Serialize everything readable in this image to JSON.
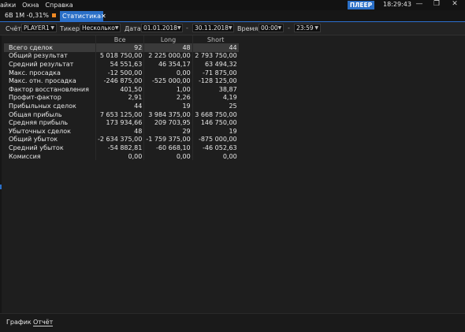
{
  "menu": {
    "items": [
      "Пайки",
      "Окна",
      "Справка"
    ],
    "player_label": "ПЛЕЕР",
    "clock": "18:29:43"
  },
  "tabs": [
    {
      "label": "6B 1M -0,31%"
    },
    {
      "label": "Статистика"
    }
  ],
  "filters": {
    "account_label": "Счёт",
    "account_value": "PLAYER1",
    "ticker_label": "Тикер",
    "ticker_value": "Несколько",
    "date_label": "Дата",
    "date_from": "01.01.2018",
    "date_to": "30.11.2018",
    "date_sep": "-",
    "time_label": "Время",
    "time_from": "00:00",
    "time_to": "23:59",
    "time_sep": "-"
  },
  "table": {
    "columns": [
      "Все",
      "Long",
      "Short"
    ],
    "rows": [
      {
        "label": "Всего сделок",
        "all": "92",
        "long": "48",
        "short": "44"
      },
      {
        "label": "Общий результат",
        "all": "5 018 750,00",
        "long": "2 225 000,00",
        "short": "2 793 750,00"
      },
      {
        "label": "Средний результат",
        "all": "54 551,63",
        "long": "46 354,17",
        "short": "63 494,32"
      },
      {
        "label": "Макс. просадка",
        "all": "-12 500,00",
        "long": "0,00",
        "short": "-71 875,00"
      },
      {
        "label": "Макс. отн. просадка",
        "all": "-246 875,00",
        "long": "-525 000,00",
        "short": "-128 125,00"
      },
      {
        "label": "Фактор восстановления",
        "all": "401,50",
        "long": "1,00",
        "short": "38,87"
      },
      {
        "label": "Профит-фактор",
        "all": "2,91",
        "long": "2,26",
        "short": "4,19"
      },
      {
        "label": "Прибыльных сделок",
        "all": "44",
        "long": "19",
        "short": "25"
      },
      {
        "label": "Общая прибыль",
        "all": "7 653 125,00",
        "long": "3 984 375,00",
        "short": "3 668 750,00"
      },
      {
        "label": "Средняя прибыль",
        "all": "173 934,66",
        "long": "209 703,95",
        "short": "146 750,00"
      },
      {
        "label": "Убыточных сделок",
        "all": "48",
        "long": "29",
        "short": "19"
      },
      {
        "label": "Общий убыток",
        "all": "-2 634 375,00",
        "long": "-1 759 375,00",
        "short": "-875 000,00"
      },
      {
        "label": "Средний убыток",
        "all": "-54 882,81",
        "long": "-60 668,10",
        "short": "-46 052,63"
      },
      {
        "label": "Комиссия",
        "all": "0,00",
        "long": "0,00",
        "short": "0,00"
      }
    ]
  },
  "bottom_tabs": [
    {
      "label": "График"
    },
    {
      "label": "Отчёт"
    }
  ],
  "colors": {
    "accent": "#2a6fc7",
    "tab_marker": "#f08a24",
    "background": "#1e1e1e"
  }
}
